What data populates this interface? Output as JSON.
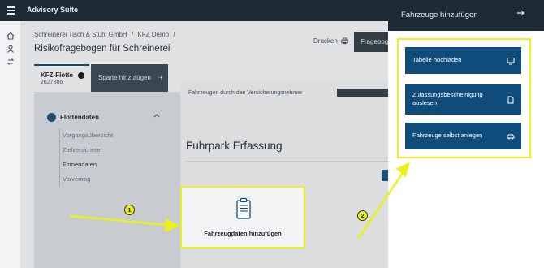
{
  "app": {
    "title": "Advisory Suite"
  },
  "rail": {
    "icons": [
      "home-icon",
      "user-icon",
      "sync-icon"
    ]
  },
  "breadcrumb": [
    "Schreinerei Tisch & Stuhl GmbH",
    "/",
    "KFZ Demo",
    "/"
  ],
  "page": {
    "title": "Risikofragebogen für Schreinerei"
  },
  "toolbar": {
    "print_label": "Drucken",
    "dark_button_label": "Fragebogs"
  },
  "tabs": {
    "active": {
      "name": "KFZ-Flotte",
      "number": "2627886"
    },
    "add_label": "Sparte hinzufügen",
    "add_symbol": "+"
  },
  "section": {
    "title": "Flottendaten",
    "items": [
      "Vorgangsübersicht",
      "Zielversicherer",
      "Firmendaten",
      "Vorvertrag"
    ],
    "active_index": 2
  },
  "main": {
    "info_text": "Fahrzeugen durch den Versicherungsnehmer",
    "heading": "Fuhrpark Erfassung",
    "upload_label": "Fahrzeugdaten hinzufügen"
  },
  "drawer": {
    "title": "Fahrzeuge hinzufügen",
    "options": [
      {
        "label": "Tabelle hochladen",
        "icon": "monitor-icon"
      },
      {
        "label": "Zulassungsbescheinigung auslesen",
        "icon": "document-icon"
      },
      {
        "label": "Fahrzeuge selbst anlegen",
        "icon": "car-icon"
      }
    ]
  },
  "annotations": {
    "badge1": "1",
    "badge2": "2"
  },
  "colors": {
    "navy": "#1d2b36",
    "primary": "#0f4c7b",
    "highlight": "#eef01a"
  }
}
